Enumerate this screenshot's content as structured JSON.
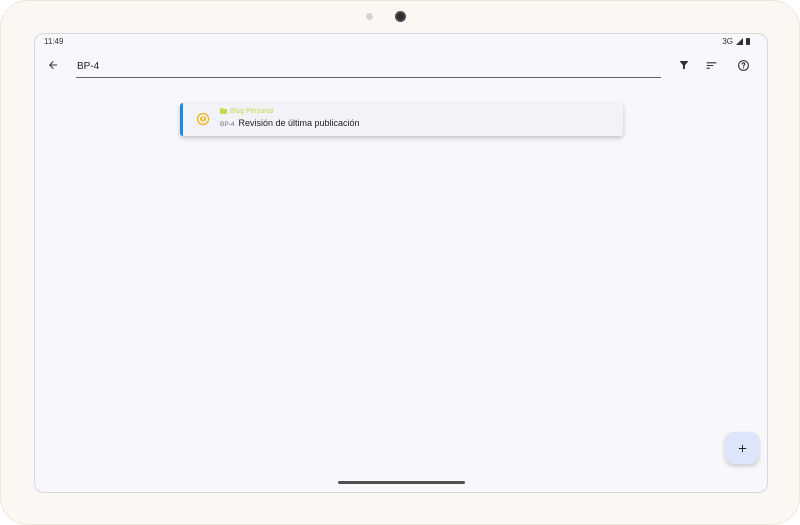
{
  "status_bar": {
    "time": "11:49",
    "network": "3G"
  },
  "toolbar": {
    "search_value": "BP-4",
    "icons": [
      "back-arrow-icon",
      "filter-icon",
      "sort-icon",
      "help-icon"
    ]
  },
  "task": {
    "project": "Blog Personal",
    "key": "BP-4",
    "title": "Revisión de última publicación",
    "status_icon": "in-progress-icon",
    "accent_color": "#1e88e5",
    "project_color": "#c6d94a",
    "status_color": "#f2b21b"
  },
  "fab": {
    "icon": "plus-icon",
    "color": "#dde5fb"
  }
}
